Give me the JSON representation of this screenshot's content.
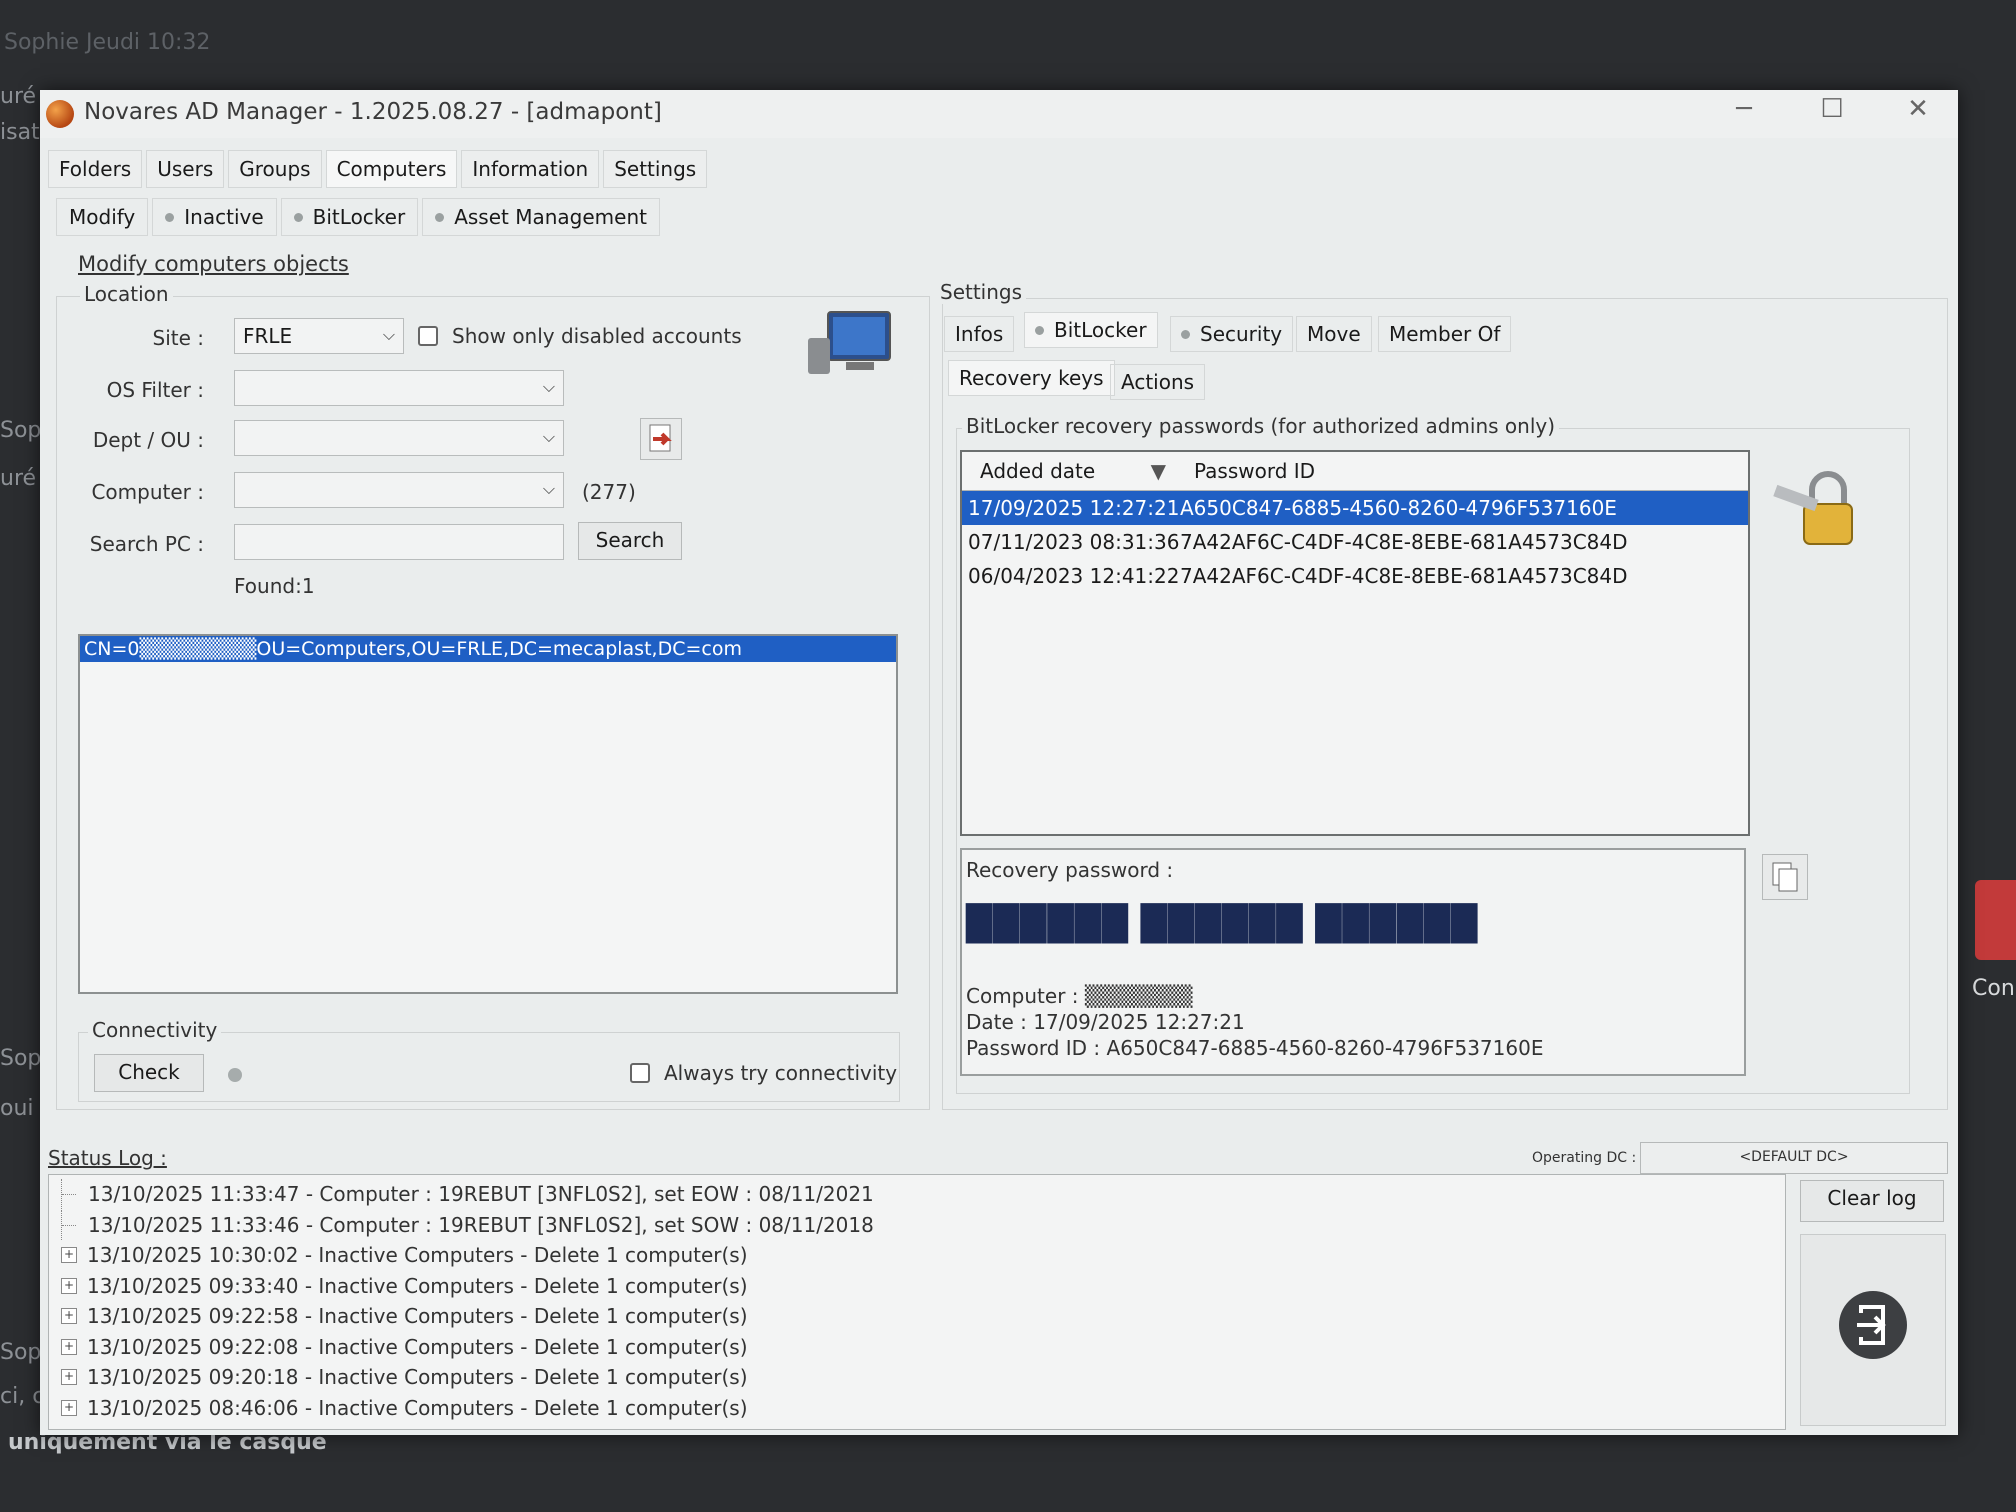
{
  "window": {
    "title": "Novares AD Manager - 1.2025.08.27 - [admapont]",
    "minimize": "─",
    "maximize": "☐",
    "close": "✕"
  },
  "menu": [
    "Folders",
    "Users",
    "Groups",
    "Computers",
    "Information",
    "Settings"
  ],
  "subtabs": [
    "Modify",
    "Inactive",
    "BitLocker",
    "Asset Management"
  ],
  "link_title": "Modify computers objects",
  "location": {
    "group_label": "Location",
    "site_label": "Site :",
    "site_value": "FRLE",
    "show_disabled_label": "Show only disabled accounts",
    "os_filter_label": "OS Filter :",
    "os_filter_value": "",
    "dept_label": "Dept / OU :",
    "dept_value": "",
    "computer_label": "Computer :",
    "computer_value": "",
    "computer_count": "(277)",
    "search_label": "Search PC :",
    "search_value": "",
    "search_button": "Search",
    "found": "Found:1"
  },
  "results": [
    "CN=0▒▒▒▒▒▒▒▒OU=Computers,OU=FRLE,DC=mecaplast,DC=com"
  ],
  "connectivity": {
    "group_label": "Connectivity",
    "check_button": "Check",
    "always_label": "Always try connectivity"
  },
  "settings": {
    "group_label": "Settings",
    "tabs": [
      "Infos",
      "BitLocker",
      "Security",
      "Move",
      "Member Of"
    ],
    "subtabs": [
      "Recovery keys",
      "Actions"
    ],
    "bitlocker_group": "BitLocker recovery passwords (for authorized admins only)",
    "columns": [
      "Added date",
      "Password ID"
    ],
    "rows": [
      {
        "date": "17/09/2025 12:27:21",
        "id": "A650C847-6885-4560-8260-4796F537160E",
        "selected": true
      },
      {
        "date": "07/11/2023 08:31:36",
        "id": "7A42AF6C-C4DF-4C8E-8EBE-681A4573C84D",
        "selected": false
      },
      {
        "date": "06/04/2023 12:41:22",
        "id": "7A42AF6C-C4DF-4C8E-8EBE-681A4573C84D",
        "selected": false
      }
    ],
    "recovery_label": "Recovery password :",
    "recovery_value": "██████ ██████ ██████",
    "computer_line": "Computer : ▒▒▒▒▒▒▒",
    "date_line": "Date : 17/09/2025 12:27:21",
    "password_id_line": "Password ID : A650C847-6885-4560-8260-4796F537160E"
  },
  "status": {
    "label": "Status Log :",
    "operating_dc_label": "Operating DC :",
    "operating_dc_value": "<DEFAULT DC>",
    "clear_log": "Clear log",
    "lines": [
      {
        "text": "13/10/2025 11:33:47 - Computer : 19REBUT [3NFL0S2], set EOW : 08/11/2021",
        "expandable": false
      },
      {
        "text": "13/10/2025 11:33:46 - Computer : 19REBUT [3NFL0S2], set SOW : 08/11/2018",
        "expandable": false
      },
      {
        "text": "13/10/2025 10:30:02 - Inactive Computers - Delete 1 computer(s)",
        "expandable": true
      },
      {
        "text": "13/10/2025 09:33:40 - Inactive Computers - Delete 1 computer(s)",
        "expandable": true
      },
      {
        "text": "13/10/2025 09:22:58 - Inactive Computers - Delete 1 computer(s)",
        "expandable": true
      },
      {
        "text": "13/10/2025 09:22:08 - Inactive Computers - Delete 1 computer(s)",
        "expandable": true
      },
      {
        "text": "13/10/2025 09:20:18 - Inactive Computers - Delete 1 computer(s)",
        "expandable": true
      },
      {
        "text": "13/10/2025 08:46:06 - Inactive Computers - Delete 1 computer(s)",
        "expandable": true
      }
    ]
  },
  "background": {
    "top": "Sophie Jeudi 10:32",
    "left_fragments": [
      "uré",
      "isat",
      "Sop",
      "uré",
      "Sop",
      "oui c",
      "Sop",
      "ci, c"
    ],
    "bottom": "uniquement via le casque",
    "right": "Con"
  },
  "colors": {
    "selection": "#1f5fc4",
    "window": "#eaeded"
  }
}
